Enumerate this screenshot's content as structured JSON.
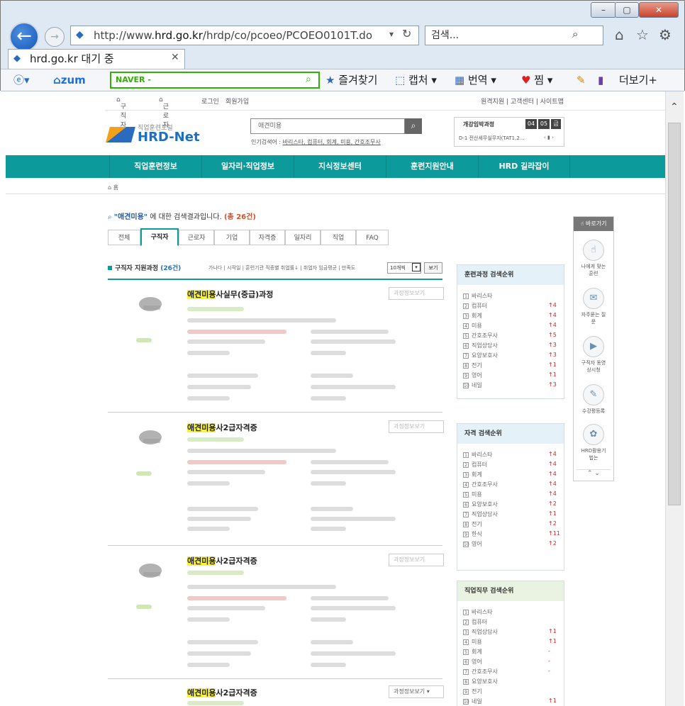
{
  "browser": {
    "url_prefix": "http://www.",
    "url_host": "hrd.go.kr",
    "url_path": "/hrdp/co/pcoeo/PCOEO0101T.do",
    "search_placeholder": "검색...",
    "tab_title": "hrd.go.kr 대기 중"
  },
  "toolbar": {
    "zum": "zum",
    "naver": "NAVER",
    "favorites": "즐겨찾기",
    "capture": "캡처",
    "translate": "번역",
    "zzim": "찜",
    "more": "더보기+"
  },
  "topmenu": {
    "seeker": "구직자",
    "worker": "근로자",
    "login": "로그인",
    "join": "회원가입",
    "util": "원격지원 | 고객센터 | 사이트맵"
  },
  "logo": {
    "sub": "직업훈련포털",
    "main": "HRD-Net"
  },
  "search": {
    "value": "애견미용",
    "popular_label": "인기검색어 :",
    "popular": "바리스타, 컴퓨터, 회계, 미용, 간호조무사"
  },
  "notice": {
    "title": "개강임박과정",
    "date": [
      "04",
      "05"
    ],
    "day": "금",
    "course": "D-1 전산세무실무자(TAT1,2..."
  },
  "gnb": [
    "직업훈련정보",
    "일자리·직업정보",
    "지식정보센터",
    "훈련지원안내",
    "HRD 길라잡이"
  ],
  "breadcrumb": "홈",
  "result": {
    "keyword": "애견미용",
    "text": " 에 대한 검색결과입니다.",
    "count": "(총 26건)"
  },
  "tabs": [
    "전체",
    "구직자",
    "근로자",
    "기업",
    "자격증",
    "일자리",
    "직업",
    "FAQ"
  ],
  "list": {
    "title": "구직자 지원과정",
    "count": "(26건)",
    "sort": "가나다 | 시작일 | 훈련기관 직종별 취업률↓ | 취업자 임금평균 | 만족도",
    "per_page": "10개씩",
    "view": "보기",
    "detail_btn": "과정정보보기"
  },
  "items": [
    {
      "kw": "애견미용",
      "rest": "사실무(중급)과정"
    },
    {
      "kw": "애견미용",
      "rest": "사2급자격증"
    },
    {
      "kw": "애견미용",
      "rest": "사2급자격증"
    },
    {
      "kw": "애견미용",
      "rest": "사2급자격증"
    }
  ],
  "rank_course": {
    "title": "훈련과정 검색순위",
    "rows": [
      [
        "1",
        "바리스타",
        ""
      ],
      [
        "2",
        "컴퓨터",
        "4"
      ],
      [
        "3",
        "회계",
        "4"
      ],
      [
        "4",
        "미용",
        "4"
      ],
      [
        "5",
        "간호조무사",
        "5"
      ],
      [
        "6",
        "직업상담사",
        "3"
      ],
      [
        "7",
        "요양보호사",
        "3"
      ],
      [
        "8",
        "전기",
        "1"
      ],
      [
        "9",
        "영어",
        "1"
      ],
      [
        "10",
        "네일",
        "3"
      ]
    ]
  },
  "rank_license": {
    "title": "자격 검색순위",
    "rows": [
      [
        "1",
        "바리스타",
        "4"
      ],
      [
        "2",
        "컴퓨터",
        "4"
      ],
      [
        "3",
        "회계",
        "4"
      ],
      [
        "4",
        "간호조무사",
        "4"
      ],
      [
        "5",
        "미용",
        "4"
      ],
      [
        "6",
        "요양보호사",
        "2"
      ],
      [
        "7",
        "직업상담사",
        "1"
      ],
      [
        "8",
        "전기",
        "2"
      ],
      [
        "9",
        "한식",
        "11"
      ],
      [
        "10",
        "영어",
        "2"
      ]
    ]
  },
  "rank_job": {
    "title": "직업직무 검색순위",
    "rows": [
      [
        "1",
        "바리스타",
        ""
      ],
      [
        "2",
        "컴퓨터",
        ""
      ],
      [
        "3",
        "직업상담사",
        "1"
      ],
      [
        "4",
        "미용",
        "1"
      ],
      [
        "5",
        "회계",
        "-"
      ],
      [
        "6",
        "영어",
        "-"
      ],
      [
        "7",
        "간호조무사",
        "-"
      ],
      [
        "8",
        "요양보호사",
        ""
      ],
      [
        "9",
        "전기",
        ""
      ],
      [
        "10",
        "네일",
        "1"
      ]
    ]
  },
  "quick": {
    "title": "바로가기",
    "items": [
      "나에게 맞는훈련",
      "자주묻는 질문",
      "구직자 동영상시청",
      "수강평등록",
      "HRD활용기 법는"
    ]
  }
}
